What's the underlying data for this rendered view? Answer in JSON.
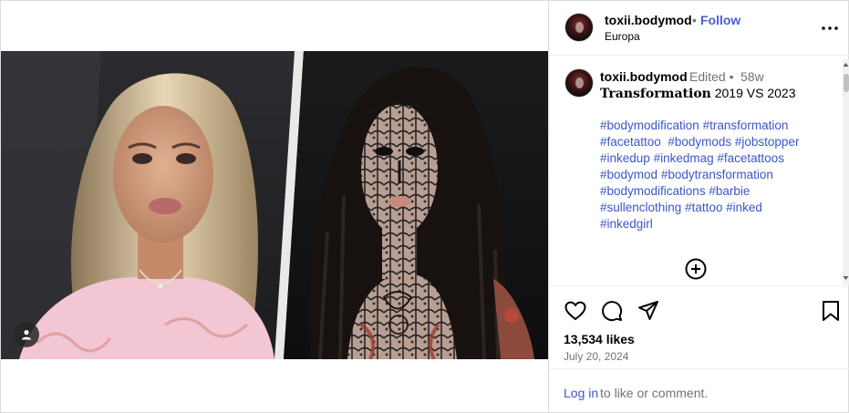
{
  "header": {
    "username": "toxii.bodymod",
    "separator": "•",
    "follow_label": "Follow",
    "location": "Europa",
    "more_icon": "more-horizontal-icon"
  },
  "caption": {
    "username": "toxii.bodymod",
    "edited": "Edited •",
    "time_ago": "58w",
    "title_bold": "Transformation",
    "title_rest": " 2019 VS 2023",
    "hashtags": [
      "#bodymodification",
      "#transformation",
      "#facetattoo",
      "#bodymods",
      "#jobstopper",
      "#inkedup",
      "#inkedmag",
      "#facetattoos",
      "#bodymod",
      "#bodytransformation",
      "#bodymodifications",
      "#barbie",
      "#sullenclothing",
      "#tattoo",
      "#inked",
      "#inkedgirl"
    ],
    "load_more_icon": "plus-circle-icon"
  },
  "actions": {
    "like_icon": "heart-icon",
    "comment_icon": "comment-icon",
    "share_icon": "send-icon",
    "save_icon": "bookmark-icon",
    "likes": "13,534 likes",
    "date": "July 20, 2024"
  },
  "login": {
    "link_label": "Log in",
    "rest": " to like or comment."
  },
  "media": {
    "user_tag_icon": "user-icon"
  },
  "colors": {
    "link_blue": "#3c56c8",
    "follow_blue": "#4a5fd4",
    "muted": "#737373",
    "border": "#dbdbdb"
  }
}
